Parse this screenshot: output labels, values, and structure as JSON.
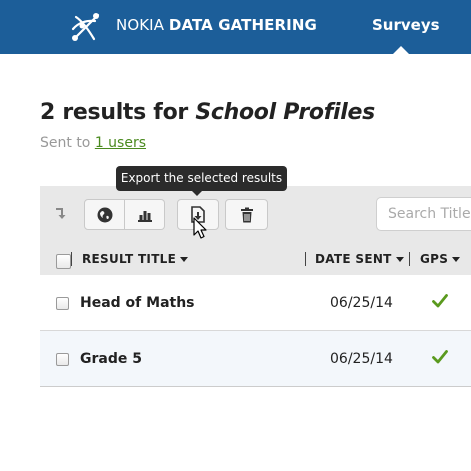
{
  "header": {
    "brand_prefix": "NOKIA ",
    "brand_bold": "DATA GATHERING",
    "nav_surveys": "Surveys",
    "colors": {
      "bar": "#1c5e99",
      "text": "#ffffff"
    }
  },
  "page": {
    "count_text": "2 results for ",
    "survey_name": "School Profiles",
    "sent_to_prefix": "Sent to ",
    "sent_to_link": "1 users"
  },
  "tooltip": {
    "text": "Export the selected results"
  },
  "toolbar": {
    "buttons": [
      {
        "icon": "globe-icon"
      },
      {
        "icon": "bar-chart-icon"
      },
      {
        "icon": "export-icon"
      },
      {
        "icon": "trash-icon"
      }
    ],
    "search_placeholder": "Search Title or"
  },
  "table": {
    "columns": [
      "RESULT TITLE",
      "DATE SENT",
      "GPS"
    ],
    "rows": [
      {
        "title": "Head of Maths",
        "date": "06/25/14",
        "gps": true
      },
      {
        "title": "Grade 5",
        "date": "06/25/14",
        "gps": true
      }
    ],
    "colors": {
      "check": "#5a9a1e",
      "link": "#4a8a1e"
    }
  }
}
